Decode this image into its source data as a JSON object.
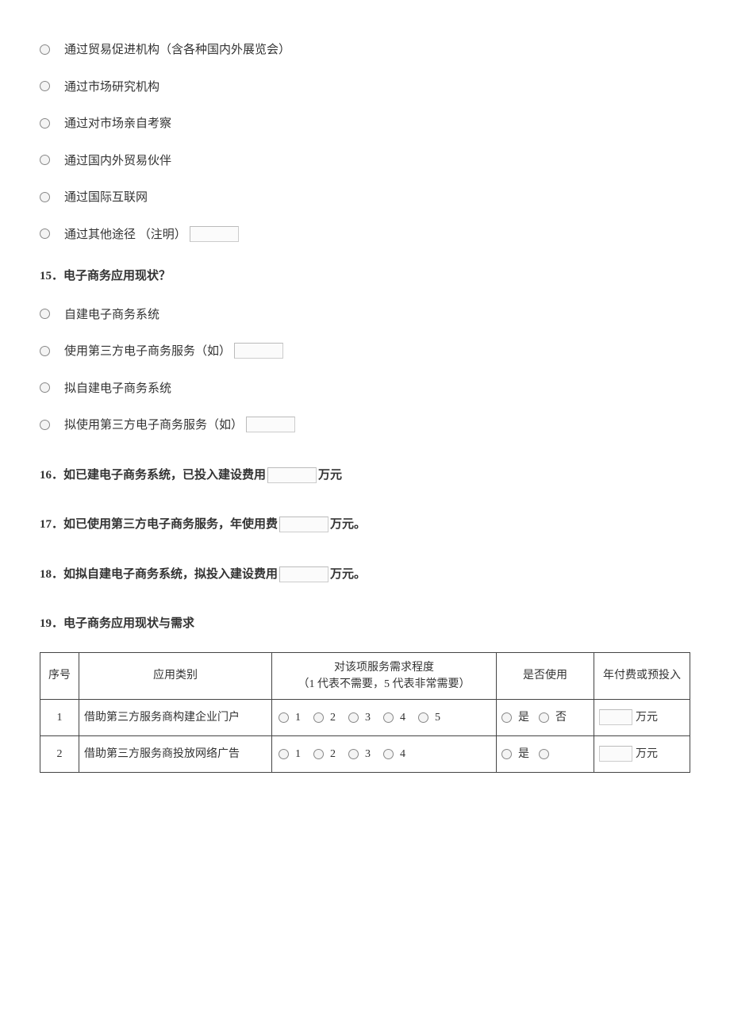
{
  "q14_options": [
    {
      "label": "通过贸易促进机构（含各种国内外展览会）"
    },
    {
      "label": "通过市场研究机构"
    },
    {
      "label": "通过对市场亲自考察"
    },
    {
      "label": "通过国内外贸易伙伴"
    },
    {
      "label": "通过国际互联网"
    },
    {
      "label": "通过其他途径 （注明）",
      "has_input": true
    }
  ],
  "q15": {
    "title": "15．电子商务应用现状？",
    "options": [
      {
        "label": "自建电子商务系统"
      },
      {
        "label": "使用第三方电子商务服务（如）",
        "has_input": true
      },
      {
        "label": "拟自建电子商务系统"
      },
      {
        "label": "拟使用第三方电子商务服务（如）",
        "has_input": true
      }
    ]
  },
  "q16": {
    "prefix": "16．如已建电子商务系统，已投入建设费用",
    "suffix": "万元"
  },
  "q17": {
    "prefix": "17．如已使用第三方电子商务服务，年使用费",
    "suffix": "万元。"
  },
  "q18": {
    "prefix": "18．如拟自建电子商务系统，拟投入建设费用",
    "suffix": "万元。"
  },
  "q19": {
    "title": "19．电子商务应用现状与需求"
  },
  "table": {
    "headers": {
      "seq": "序号",
      "category": "应用类别",
      "need_line1": "对该项服务需求程度",
      "need_line2": "（1 代表不需要，5 代表非常需要）",
      "use": "是否使用",
      "cost": "年付费或预投入"
    },
    "ratings": [
      "1",
      "2",
      "3",
      "4",
      "5"
    ],
    "yes": "是",
    "no": "否",
    "unit": "万元",
    "rows": [
      {
        "seq": "1",
        "category": "借助第三方服务商构建企业门户",
        "show_five": true
      },
      {
        "seq": "2",
        "category": "借助第三方服务商投放网络广告",
        "show_five": false
      }
    ]
  }
}
